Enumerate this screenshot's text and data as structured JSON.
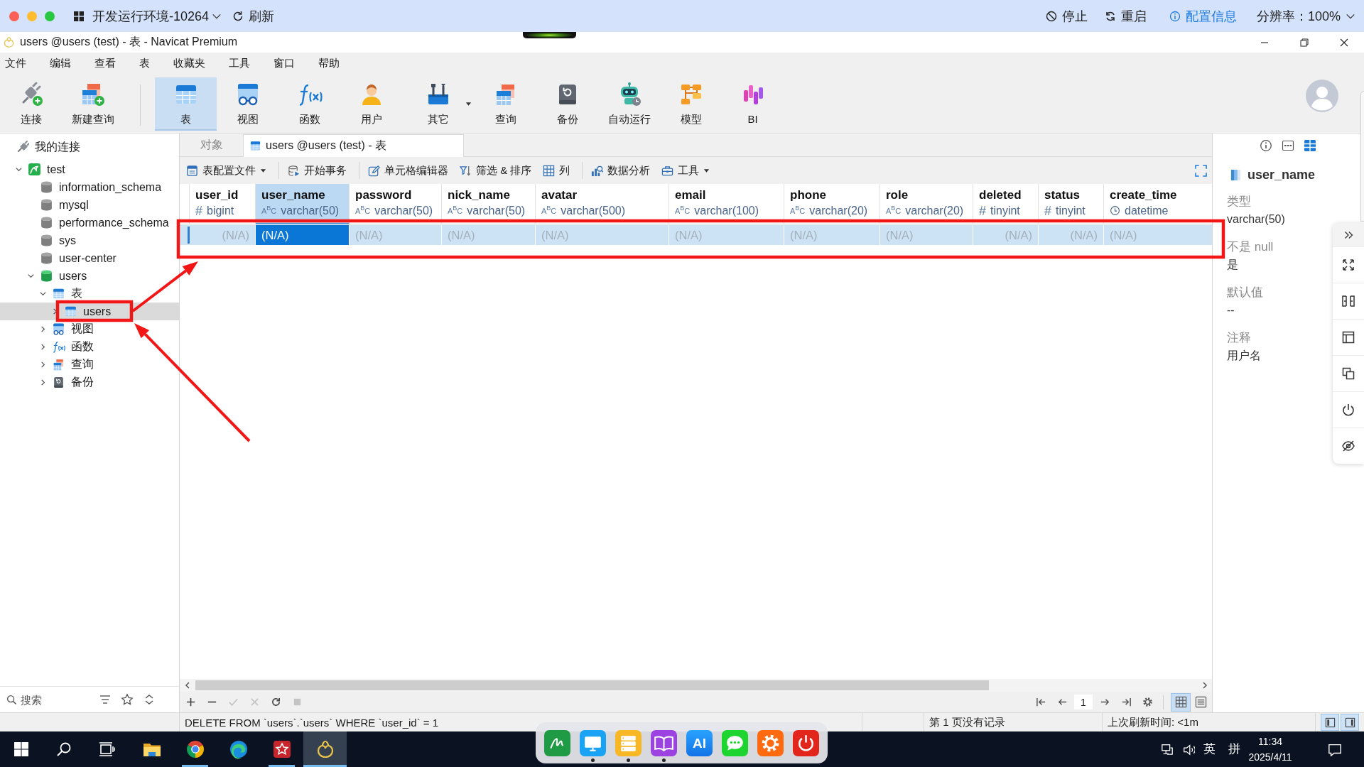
{
  "top_bar": {
    "environment": "开发运行环境-10264",
    "refresh": "刷新",
    "actions": [
      {
        "kind": "stop",
        "label": "停止"
      },
      {
        "kind": "restart",
        "label": "重启"
      },
      {
        "kind": "info",
        "label": "配置信息"
      }
    ],
    "resolution": "分辨率：100%"
  },
  "window": {
    "title": "users @users (test) - 表 - Navicat Premium"
  },
  "menu": [
    "文件",
    "编辑",
    "查看",
    "表",
    "收藏夹",
    "工具",
    "窗口",
    "帮助"
  ],
  "toolbar": [
    {
      "items": [
        {
          "kind": "connection",
          "label": "连接",
          "selected": false
        },
        {
          "kind": "new-query",
          "label": "新建查询",
          "selected": false
        }
      ]
    },
    {
      "items": [
        {
          "kind": "table",
          "label": "表",
          "selected": true
        },
        {
          "kind": "view",
          "label": "视图",
          "selected": false
        },
        {
          "kind": "function",
          "label": "函数",
          "selected": false
        },
        {
          "kind": "user",
          "label": "用户",
          "selected": false
        },
        {
          "kind": "other",
          "label": "其它",
          "selected": false,
          "dropdown": true
        },
        {
          "kind": "query",
          "label": "查询",
          "selected": false
        },
        {
          "kind": "backup",
          "label": "备份",
          "selected": false
        },
        {
          "kind": "automation",
          "label": "自动运行",
          "selected": false
        },
        {
          "kind": "model",
          "label": "模型",
          "selected": false
        },
        {
          "kind": "bi",
          "label": "BI",
          "selected": false
        }
      ]
    }
  ],
  "sidebar": {
    "header": "我的连接",
    "tree": [
      {
        "kind": "server",
        "label": "test",
        "expanded": true,
        "selected": false,
        "children": [
          {
            "kind": "database",
            "label": "information_schema",
            "open": false,
            "selected": false
          },
          {
            "kind": "database",
            "label": "mysql",
            "open": false,
            "selected": false
          },
          {
            "kind": "database",
            "label": "performance_schema",
            "open": false,
            "selected": false
          },
          {
            "kind": "database",
            "label": "sys",
            "open": false,
            "selected": false
          },
          {
            "kind": "database",
            "label": "user-center",
            "open": false,
            "selected": false
          },
          {
            "kind": "database",
            "label": "users",
            "open": true,
            "expanded": true,
            "selected": false,
            "children": [
              {
                "kind": "tables",
                "label": "表",
                "expanded": true,
                "selected": false,
                "children": [
                  {
                    "kind": "table",
                    "label": "users",
                    "expanded": false,
                    "selected": true,
                    "annotated": true
                  }
                ]
              },
              {
                "kind": "views",
                "label": "视图",
                "expanded": false,
                "selected": false
              },
              {
                "kind": "functions",
                "label": "函数",
                "expanded": false,
                "selected": false
              },
              {
                "kind": "queries",
                "label": "查询",
                "expanded": false,
                "selected": false
              },
              {
                "kind": "backups",
                "label": "备份",
                "expanded": false,
                "selected": false
              }
            ]
          }
        ]
      }
    ],
    "search": {
      "placeholder": "搜索"
    }
  },
  "tabs": [
    {
      "kind": "objects",
      "label": "对象",
      "selected": false
    },
    {
      "kind": "table",
      "label": "users @users (test) - 表",
      "selected": true
    }
  ],
  "grid_toolbar": [
    {
      "items": [
        {
          "kind": "profile",
          "label": "表配置文件",
          "dropdown": true
        }
      ]
    },
    {
      "items": [
        {
          "kind": "transaction",
          "label": "开始事务"
        }
      ]
    },
    {
      "items": [
        {
          "kind": "cell-editor",
          "label": "单元格编辑器"
        },
        {
          "kind": "filter-sort",
          "label": "筛选 & 排序"
        },
        {
          "kind": "columns",
          "label": "列"
        }
      ]
    },
    {
      "items": [
        {
          "kind": "analysis",
          "label": "数据分析"
        },
        {
          "kind": "tools",
          "label": "工具",
          "dropdown": true
        }
      ]
    }
  ],
  "table": {
    "columns": [
      {
        "name": "user_id",
        "kind": "number",
        "type_mark": "#",
        "type": "bigint",
        "selected": false
      },
      {
        "name": "user_name",
        "kind": "text",
        "type_mark": "A$^{B}$C",
        "type": "varchar(50)",
        "selected": true
      },
      {
        "name": "password",
        "kind": "text",
        "type_mark": "A$^{B}$C",
        "type": "varchar(50)",
        "selected": false
      },
      {
        "name": "nick_name",
        "kind": "text",
        "type_mark": "A$^{B}$C",
        "type": "varchar(50)",
        "selected": false
      },
      {
        "name": "avatar",
        "kind": "text",
        "type_mark": "A$^{B}$C",
        "type": "varchar(500)",
        "selected": false
      },
      {
        "name": "email",
        "kind": "text",
        "type_mark": "A$^{B}$C",
        "type": "varchar(100)",
        "selected": false
      },
      {
        "name": "phone",
        "kind": "text",
        "type_mark": "A$^{B}$C",
        "type": "varchar(20)",
        "selected": false
      },
      {
        "name": "role",
        "kind": "text",
        "type_mark": "A$^{B}$C",
        "type": "varchar(20)",
        "selected": false
      },
      {
        "name": "deleted",
        "kind": "number",
        "type_mark": "#",
        "type": "tinyint",
        "selected": false
      },
      {
        "name": "status",
        "kind": "number",
        "type_mark": "#",
        "type": "tinyint",
        "selected": false
      },
      {
        "name": "create_time",
        "kind": "datetime",
        "type": "datetime",
        "selected": false
      }
    ],
    "rows": [
      {
        "selected": true,
        "annotated": true,
        "cells": [
          "(N/A)",
          "(N/A)",
          "(N/A)",
          "(N/A)",
          "(N/A)",
          "(N/A)",
          "(N/A)",
          "(N/A)",
          "(N/A)",
          "(N/A)",
          "(N/A)"
        ]
      }
    ]
  },
  "record_bar": {
    "tools": [
      {
        "kind": "add",
        "disabled": false
      },
      {
        "kind": "remove",
        "disabled": false
      },
      {
        "kind": "apply",
        "disabled": true
      },
      {
        "kind": "discard",
        "disabled": true
      },
      {
        "kind": "refresh",
        "disabled": false
      },
      {
        "kind": "stop",
        "disabled": true
      }
    ],
    "page": "1",
    "views": [
      {
        "kind": "grid",
        "selected": true
      },
      {
        "kind": "form",
        "selected": false
      }
    ]
  },
  "details": {
    "tabs": [
      {
        "kind": "info",
        "selected": false
      },
      {
        "kind": "ddl",
        "selected": false
      },
      {
        "kind": "fields",
        "selected": true
      }
    ],
    "field": "user_name",
    "properties": [
      {
        "label": "类型",
        "value": "varchar(50)"
      },
      {
        "label": "不是 null",
        "value": "是"
      },
      {
        "label": "默认值",
        "value": "--"
      },
      {
        "label": "注释",
        "value": "用户名"
      }
    ]
  },
  "status_bar": {
    "sql": "DELETE FROM `users`.`users` WHERE `user_id` = 1",
    "page_info": "第 1 页没有记录",
    "refresh_info": "上次刷新时间: <1m",
    "panels": [
      {
        "kind": "left",
        "on": true
      },
      {
        "kind": "right",
        "on": true
      }
    ]
  },
  "taskbar": {
    "apps": [
      {
        "kind": "folder",
        "running": false,
        "selected": false
      },
      {
        "kind": "round-browser",
        "running": true,
        "selected": false
      },
      {
        "kind": "wave-browser",
        "running": false,
        "selected": false
      },
      {
        "kind": "star-app",
        "running": true,
        "selected": false
      },
      {
        "kind": "db-client",
        "running": true,
        "selected": true
      }
    ],
    "input_mode": "英",
    "ime": "拼",
    "time": "11:34",
    "date": "2025/4/11"
  },
  "dock": [
    {
      "kind": "pen",
      "running": false
    },
    {
      "kind": "monitor",
      "running": true
    },
    {
      "kind": "server",
      "running": true
    },
    {
      "kind": "book",
      "running": true
    },
    {
      "kind": "ai",
      "label": "AI",
      "running": false
    },
    {
      "kind": "chat",
      "running": false
    },
    {
      "kind": "gear",
      "running": false
    },
    {
      "kind": "power",
      "running": false
    }
  ]
}
